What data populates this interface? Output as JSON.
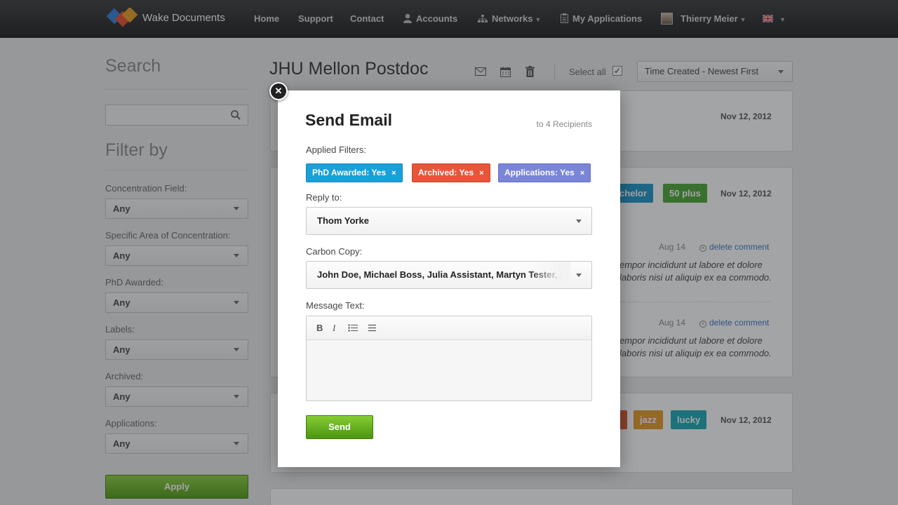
{
  "nav": {
    "brand": "Wake Documents",
    "home": "Home",
    "support": "Support",
    "contact": "Contact",
    "accounts": "Accounts",
    "networks": "Networks",
    "my_applications": "My Applications",
    "user": "Thierry Meier"
  },
  "sidebar": {
    "search_title": "Search",
    "filter_title": "Filter by",
    "filters": [
      {
        "label": "Concentration Field:",
        "value": "Any"
      },
      {
        "label": "Specific Area of Concentration:",
        "value": "Any"
      },
      {
        "label": "PhD Awarded:",
        "value": "Any"
      },
      {
        "label": "Labels:",
        "value": "Any"
      },
      {
        "label": "Archived:",
        "value": "Any"
      },
      {
        "label": "Applications:",
        "value": "Any"
      }
    ],
    "apply_label": "Apply"
  },
  "main": {
    "title": "JHU Mellon Postdoc",
    "select_all": "Select all",
    "sort": "Time Created - Newest First",
    "cards": [
      {
        "date": "Nov 12, 2012"
      },
      {
        "date": "Nov 12, 2012",
        "tags": [
          "chelor",
          "50 plus"
        ],
        "comments": [
          {
            "date": "Aug 14",
            "delete": "delete comment",
            "text1": "empor incididunt ut labore et dolore",
            "text2": "laboris nisi ut aliquip ex ea commodo."
          },
          {
            "date": "Aug 14",
            "delete": "delete comment",
            "text1": "empor incididunt ut labore et dolore",
            "text2": "laboris nisi ut aliquip ex ea commodo."
          }
        ]
      },
      {
        "date": "Nov 12, 2012",
        "tags": [
          "jazz",
          "lucky"
        ]
      }
    ]
  },
  "modal": {
    "title": "Send Email",
    "recipients": "to 4 Recipients",
    "applied_filters_label": "Applied Filters:",
    "chips": [
      {
        "label": "PhD Awarded: Yes",
        "color": "#1aa0d8"
      },
      {
        "label": "Archived: Yes",
        "color": "#e8553a"
      },
      {
        "label": "Applications: Yes",
        "color": "#7a85d8"
      }
    ],
    "reply_to_label": "Reply to:",
    "reply_to_value": "Thom Yorke",
    "cc_label": "Carbon Copy:",
    "cc_value": "John Doe, Michael Boss, Julia Assistant, Martyn Tester, L",
    "message_label": "Message Text:",
    "editor": {
      "bold": "B",
      "italic": "I"
    },
    "send_label": "Send"
  },
  "colors": {
    "tag_blue": "#1c95c9",
    "tag_green": "#4aa532",
    "tag_orange": "#e39a22",
    "tag_teal": "#19a8b3",
    "tag_red": "#d9532f"
  }
}
